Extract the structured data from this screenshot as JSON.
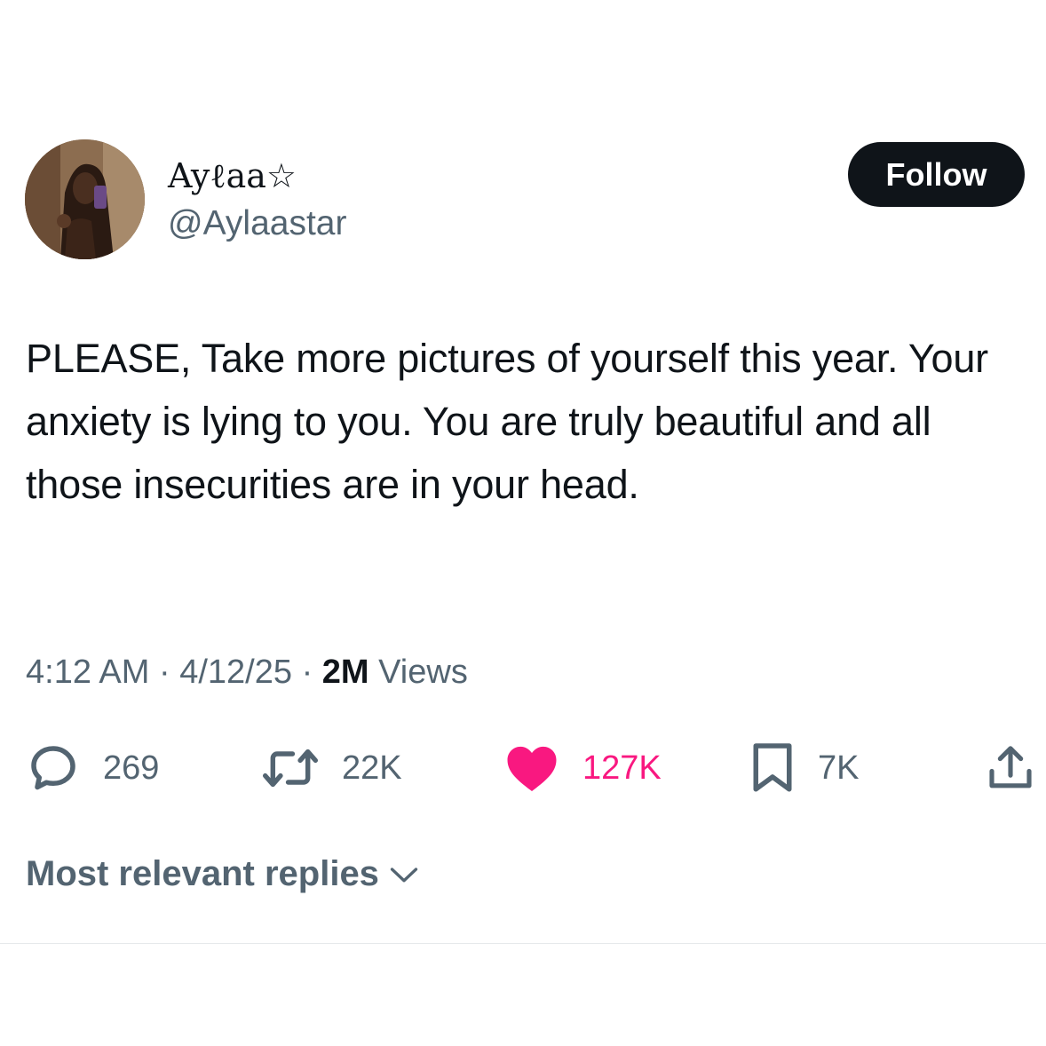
{
  "author": {
    "display_name": "Ayℓaa☆",
    "handle": "@Aylaastar"
  },
  "follow_button": {
    "label": "Follow"
  },
  "tweet": {
    "text": "PLEASE, Take more pictures of yourself this year. Your anxiety is lying to you. You are truly beautiful and all those insecurities are in your head."
  },
  "meta": {
    "time": "4:12 AM",
    "separator": "·",
    "date": "4/12/25",
    "views_count": "2M",
    "views_label": "Views"
  },
  "actions": {
    "replies": "269",
    "retweets": "22K",
    "likes": "127K",
    "bookmarks": "7K"
  },
  "replies_sort": {
    "label": "Most relevant replies"
  },
  "colors": {
    "text": "#0f1419",
    "secondary": "#536471",
    "like": "#f91880",
    "button": "#0f1419",
    "divider": "#e6e9eb"
  },
  "icons": {
    "reply": "speech-bubble-icon",
    "retweet": "retweet-icon",
    "like": "heart-icon",
    "bookmark": "bookmark-icon",
    "share": "share-icon",
    "sort": "chevron-down-icon"
  }
}
